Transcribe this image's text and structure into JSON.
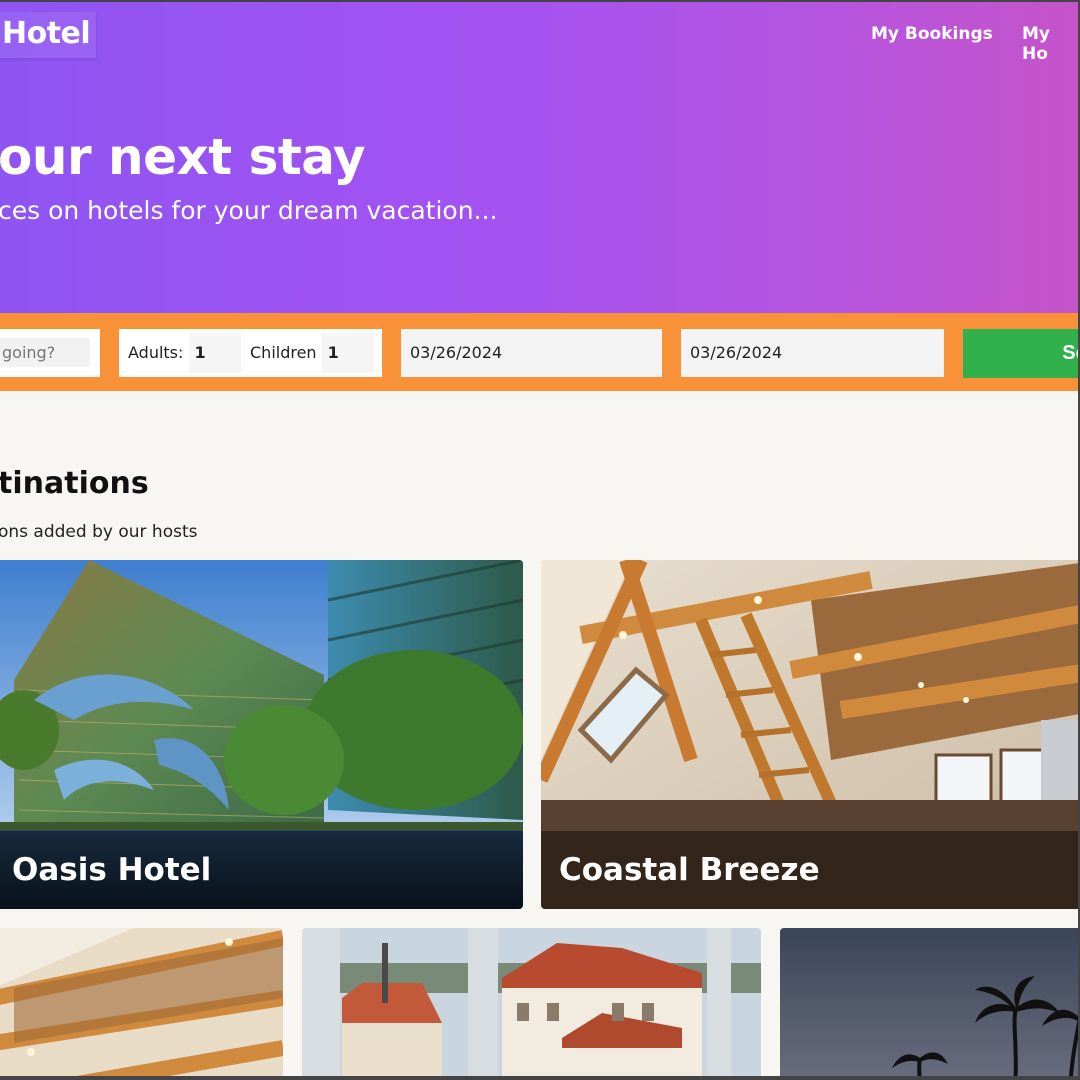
{
  "header": {
    "logo": "Hotel",
    "nav": [
      "My Bookings",
      "My Ho"
    ]
  },
  "hero": {
    "title": "our next stay",
    "subtitle": "ces on hotels for your dream vacation..."
  },
  "search": {
    "destination_placeholder": "going?",
    "adults_label": "Adults:",
    "adults_value": "1",
    "children_label": "Children",
    "children_value": "1",
    "check_in": "03/26/2024",
    "check_out": "03/26/2024",
    "button_label": "Se"
  },
  "destinations": {
    "title": "tinations",
    "subtitle": "ons added by our hosts",
    "cards": [
      {
        "name": "Oasis Hotel"
      },
      {
        "name": "Coastal Breeze"
      },
      {
        "name": ""
      },
      {
        "name": ""
      },
      {
        "name": ""
      }
    ]
  },
  "colors": {
    "hero_start": "#8e55f2",
    "hero_end": "#c653c9",
    "search_bar": "#f99139",
    "search_button": "#31b14b"
  }
}
